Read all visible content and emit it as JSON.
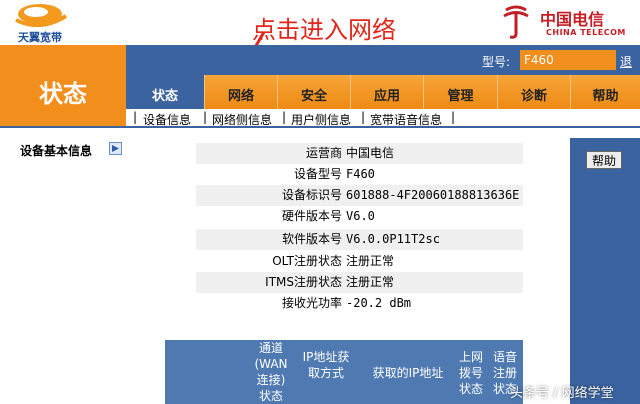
{
  "header": {
    "brand_logo_text": "天翼宽带",
    "annotation": "点击进入网络",
    "carrier_name": "中国电信",
    "carrier_name_en": "CHINA TELECOM"
  },
  "sidebar": {
    "title": "状态",
    "section_label": "设备基本信息"
  },
  "model": {
    "label": "型号:",
    "value": "F460",
    "exit_label": "退"
  },
  "nav": {
    "tabs": [
      {
        "label": "状态"
      },
      {
        "label": "网络"
      },
      {
        "label": "安全"
      },
      {
        "label": "应用"
      },
      {
        "label": "管理"
      },
      {
        "label": "诊断"
      },
      {
        "label": "帮助"
      }
    ],
    "active_tab": "状态"
  },
  "subnav": {
    "items": [
      {
        "label": "设备信息"
      },
      {
        "label": "网络侧信息"
      },
      {
        "label": "用户侧信息"
      },
      {
        "label": "宽带语音信息"
      }
    ]
  },
  "help_button": "帮助",
  "device_info": [
    {
      "label": "运营商",
      "value": "中国电信"
    },
    {
      "label": "设备型号",
      "value": "F460"
    },
    {
      "label": "设备标识号",
      "value": "601888-4F20060188813636E"
    },
    {
      "label": "硬件版本号",
      "value": "V6.0"
    },
    {
      "label": "软件版本号",
      "value": "V6.0.0P11T2sc"
    },
    {
      "label": "OLT注册状态",
      "value": "注册正常"
    },
    {
      "label": "ITMS注册状态",
      "value": "注册正常"
    },
    {
      "label": "接收光功率",
      "value": "-20.2 dBm"
    }
  ],
  "wan_table": {
    "headers": [
      "通道\n(WAN\n连接)\n状态",
      "IP地址获\n取方式",
      "获取的IP地址",
      "上网\n拨号\n状态",
      "语音\n注册\n状态"
    ]
  },
  "watermark": "头条号 / 网络学堂",
  "colors": {
    "orange": "#f28e1c",
    "blue": "#3b63a0",
    "annotation_red": "#e3261b"
  }
}
